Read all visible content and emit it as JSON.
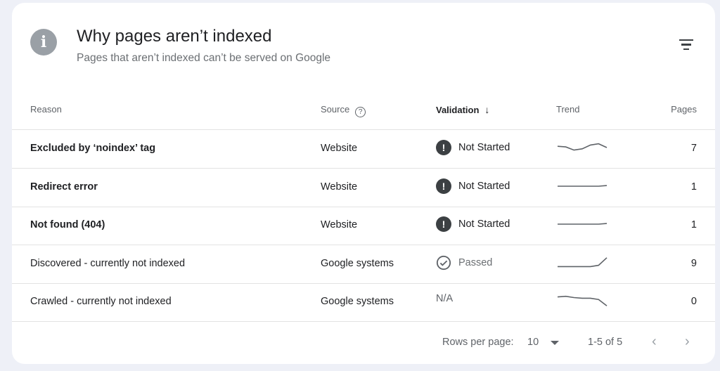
{
  "header": {
    "title": "Why pages aren’t indexed",
    "subtitle": "Pages that aren’t indexed can’t be served on Google",
    "info_icon": "info-icon",
    "filter_icon": "filter-icon"
  },
  "columns": {
    "reason": "Reason",
    "source": "Source",
    "validation": "Validation",
    "trend": "Trend",
    "pages": "Pages"
  },
  "rows": [
    {
      "reason": "Excluded by ‘noindex’ tag",
      "source": "Website",
      "validation": "Not Started",
      "validation_icon": "alert-icon",
      "pages": "7",
      "trend": [
        0.6,
        0.55,
        0.3,
        0.4,
        0.7,
        0.8,
        0.5
      ],
      "emphasis": true
    },
    {
      "reason": "Redirect error",
      "source": "Website",
      "validation": "Not Started",
      "validation_icon": "alert-icon",
      "pages": "1",
      "trend": [
        0.5,
        0.5,
        0.5,
        0.5,
        0.5,
        0.5,
        0.55
      ],
      "emphasis": true
    },
    {
      "reason": "Not found (404)",
      "source": "Website",
      "validation": "Not Started",
      "validation_icon": "alert-icon",
      "pages": "1",
      "trend": [
        0.5,
        0.5,
        0.5,
        0.5,
        0.5,
        0.5,
        0.55
      ],
      "emphasis": true
    },
    {
      "reason": "Discovered - currently not indexed",
      "source": "Google systems",
      "validation": "Passed",
      "validation_icon": "check-circle-icon",
      "pages": "9",
      "trend": [
        0.2,
        0.2,
        0.2,
        0.2,
        0.2,
        0.3,
        0.9
      ],
      "emphasis": false
    },
    {
      "reason": "Crawled - currently not indexed",
      "source": "Google systems",
      "validation": "N/A",
      "validation_icon": "",
      "pages": "0",
      "trend": [
        0.8,
        0.85,
        0.75,
        0.7,
        0.7,
        0.6,
        0.1
      ],
      "emphasis": false
    }
  ],
  "pagination": {
    "rows_per_page_label": "Rows per page:",
    "rows_per_page_value": "10",
    "range": "1-5 of 5"
  },
  "colors": {
    "accent": "#3c4043",
    "muted": "#9aa0a6",
    "background": "#eef0f7"
  }
}
